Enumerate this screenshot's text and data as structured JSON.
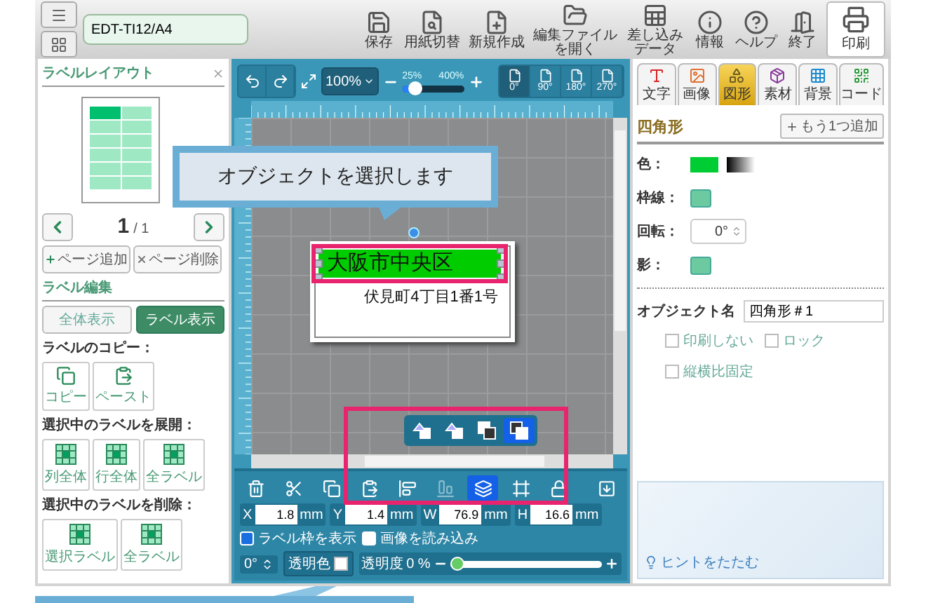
{
  "toolbar": {
    "file_name": "EDT-TI12/A4",
    "buttons": [
      {
        "label": "保存"
      },
      {
        "label": "用紙切替"
      },
      {
        "label": "新規作成"
      },
      {
        "label": "編集ファイルを開く"
      },
      {
        "label": "差し込みデータ"
      },
      {
        "label": "情報"
      },
      {
        "label": "ヘルプ"
      },
      {
        "label": "終了"
      }
    ],
    "print_button": "印刷"
  },
  "left_panel": {
    "title": "ラベルレイアウト",
    "preview_cells": [
      {
        "selected": true
      },
      {
        "selected": false
      },
      {
        "selected": false
      },
      {
        "selected": false
      },
      {
        "selected": false
      },
      {
        "selected": false
      },
      {
        "selected": false
      },
      {
        "selected": false
      },
      {
        "selected": false
      },
      {
        "selected": false
      },
      {
        "selected": false
      },
      {
        "selected": false
      }
    ],
    "pager": {
      "current": "1",
      "total": "/ 1"
    },
    "page_buttons": [
      {
        "kind": "add",
        "label": "ページ追加"
      },
      {
        "kind": "delete",
        "label": "ページ削除"
      }
    ],
    "section_title": "ラベル編集",
    "view_toggle": [
      {
        "label": "全体表示",
        "selected": false
      },
      {
        "label": "ラベル表示",
        "selected": true
      }
    ],
    "groups": [
      {
        "heading": "ラベルのコピー：",
        "buttons": [
          {
            "kind": "copy",
            "label": "コピー"
          },
          {
            "kind": "paste",
            "label": "ペースト"
          }
        ]
      },
      {
        "heading": "選択中のラベルを展開：",
        "buttons": [
          {
            "kind": "grid",
            "label": "列全体"
          },
          {
            "kind": "grid",
            "label": "行全体"
          },
          {
            "kind": "grid",
            "label": "全ラベル"
          }
        ]
      },
      {
        "heading": "選択中のラベルを削除：",
        "buttons": [
          {
            "kind": "grid",
            "label": "選択ラベル"
          },
          {
            "kind": "grid",
            "label": "全ラベル"
          }
        ]
      }
    ]
  },
  "canvas": {
    "zoom": "100%",
    "zoom_min": "25%",
    "zoom_max": "400%",
    "zoom_slider": {
      "level": 0.22
    },
    "rotations": [
      {
        "label": "0°",
        "selected": true
      },
      {
        "label": "90°",
        "selected": false
      },
      {
        "label": "180°",
        "selected": false
      },
      {
        "label": "270°",
        "selected": false
      }
    ],
    "label_lines": [
      {
        "text": "大阪市中央区",
        "selected": true
      },
      {
        "text": "伏見町4丁目1番1号",
        "selected": false
      }
    ],
    "callout": "オブジェクトを選択します",
    "arrange_buttons": [
      {
        "selected": false
      },
      {
        "selected": false
      },
      {
        "selected": false
      },
      {
        "selected": true
      }
    ],
    "tools": [
      {
        "selected": false,
        "disabled": false
      },
      {
        "selected": false,
        "disabled": false
      },
      {
        "selected": false,
        "disabled": false
      },
      {
        "selected": false,
        "disabled": false
      },
      {
        "selected": false,
        "disabled": false
      },
      {
        "selected": false,
        "disabled": true
      },
      {
        "selected": true,
        "disabled": false
      },
      {
        "selected": false,
        "disabled": false
      },
      {
        "selected": false,
        "disabled": false
      }
    ],
    "fields": [
      {
        "label": "X",
        "value": "1.8",
        "unit": "mm"
      },
      {
        "label": "Y",
        "value": "1.4",
        "unit": "mm"
      },
      {
        "label": "W",
        "value": "76.9",
        "unit": "mm"
      },
      {
        "label": "H",
        "value": "16.6",
        "unit": "mm"
      }
    ],
    "checkboxes": [
      {
        "label": "ラベル枠を表示",
        "checked": true
      },
      {
        "label": "画像を読み込み",
        "checked": false
      }
    ],
    "rotation": "0°",
    "transparent_color": "透明色",
    "opacity": {
      "label": "透明度",
      "value": "0",
      "unit": "%",
      "level": 0.05
    }
  },
  "right_panel": {
    "tabs": [
      {
        "label": "文字",
        "selected": false
      },
      {
        "label": "画像",
        "selected": false
      },
      {
        "label": "図形",
        "selected": true
      },
      {
        "label": "素材",
        "selected": false
      },
      {
        "label": "背景",
        "selected": false
      },
      {
        "label": "コード",
        "selected": false
      }
    ],
    "section_title": "四角形",
    "add_button": "もう1つ追加",
    "color_label": "色：",
    "border_label": "枠線：",
    "rotation_label": "回転：",
    "rotation_value": "0°",
    "shadow_label": "影：",
    "object_name_label": "オブジェクト名",
    "object_name": "四角形＃1",
    "options": [
      {
        "label": "印刷しない",
        "checked": false
      },
      {
        "label": "ロック",
        "checked": false
      },
      {
        "label": "縦横比固定",
        "checked": false
      }
    ],
    "hint_button": "ヒントをたたむ"
  }
}
